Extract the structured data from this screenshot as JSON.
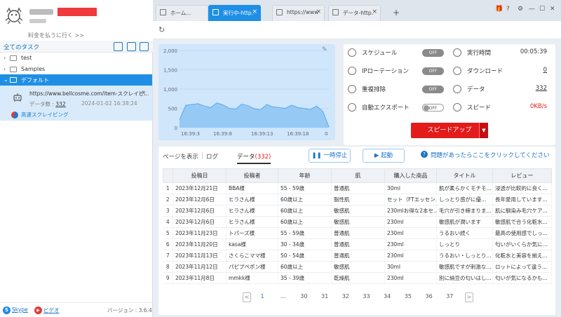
{
  "user": {
    "pay_link": "料金を払うに行く >>"
  },
  "tasks": {
    "header": "全てのタスク",
    "tree": [
      {
        "label": "test",
        "expanded": false
      },
      {
        "label": "Samples",
        "expanded": false
      },
      {
        "label": "デフォルト",
        "expanded": true,
        "selected": true
      }
    ],
    "active_task": {
      "url": "https://www.bellcosme.com/item-スクレイピ...",
      "count_label": "データ数 : ",
      "count": "332",
      "datetime": "2024-01-02 16:38:24",
      "mode": "高速スクレイピング"
    }
  },
  "footer": {
    "skype": "Skype",
    "video": "ビデオ",
    "version": "バージョン : 3.6.4"
  },
  "tabs": [
    {
      "label": "ホーム...",
      "active": false,
      "closable": false
    },
    {
      "label": "実行中-http...",
      "active": true,
      "closable": true
    },
    {
      "label": "https://www...",
      "active": false,
      "closable": true
    },
    {
      "label": "データ-http...",
      "active": false,
      "closable": true
    }
  ],
  "chart_data": {
    "type": "area",
    "title": "",
    "xlabel": "",
    "ylabel": "",
    "ylim": [
      0,
      2000
    ],
    "y_ticks": [
      "0",
      "500",
      "1,000",
      "1,500",
      "2,000"
    ],
    "x_ticks": [
      "16:39:3",
      "16:39:8",
      "16:39:13",
      "16:39:18",
      "0"
    ],
    "x": [
      0,
      1,
      2,
      3,
      4,
      5,
      6,
      7,
      8,
      9,
      10,
      11,
      12,
      13,
      14,
      15,
      16,
      17,
      18,
      19,
      20,
      21,
      22,
      23,
      24
    ],
    "values": [
      200,
      580,
      600,
      620,
      560,
      520,
      640,
      590,
      500,
      480,
      610,
      570,
      490,
      460,
      600,
      540,
      520,
      500,
      580,
      520,
      500,
      470,
      560,
      430,
      20
    ],
    "grid": true
  },
  "settings": [
    {
      "icon": "schedule-icon",
      "label": "スケジュール",
      "toggle": "OFF"
    },
    {
      "icon": "clock-icon",
      "label": "実行時間",
      "value": "00:05:39"
    },
    {
      "icon": "globe-icon",
      "label": "IPローテーション",
      "toggle": "OFF"
    },
    {
      "icon": "download-icon",
      "label": "ダウンロード",
      "value": "0",
      "link": true
    },
    {
      "icon": "dedupe-icon",
      "label": "重複排除",
      "toggle": "OFF"
    },
    {
      "icon": "data-icon",
      "label": "データ",
      "value": "332",
      "link": true
    },
    {
      "icon": "export-icon",
      "label": "自動エクスポート",
      "toggle": "OFF",
      "toggle_style": "outline"
    },
    {
      "icon": "speed-icon",
      "label": "スピード",
      "value": "0KB/s",
      "value_color": "#e31b1b"
    }
  ],
  "speed_button": "スピードアップ",
  "data_tabs": {
    "page": "ページを表示",
    "log": "ログ",
    "data": "データ",
    "data_count": "(332)"
  },
  "actions": {
    "pause": "一時停止",
    "start": "起動",
    "help": "問題があったらここをクリックしてください"
  },
  "table": {
    "columns": [
      "",
      "投稿日",
      "投稿者",
      "年齢",
      "肌",
      "購入した商品",
      "タイトル",
      "レビュー"
    ],
    "rows": [
      [
        "1",
        "2023年12月21日",
        "BBA様",
        "55 - 59歳",
        "普通肌",
        "30ml",
        "肌が柔らかくモチモ...",
        "浸透が比較的に良く..."
      ],
      [
        "2",
        "2023年12月6日",
        "ヒラさん様",
        "60歳以上",
        "脂性肌",
        "セット（FTエッセン...",
        "しっとり感がに優...",
        "長年愛用しています..."
      ],
      [
        "3",
        "2023年12月6日",
        "ヒラさん様",
        "60歳以上",
        "敏感肌",
        "230mlお得な2本セ...",
        "毛穴が引き締まりま...",
        "肌に馴染み毛穴ケア..."
      ],
      [
        "4",
        "2023年12月6日",
        "ヒラさん様",
        "60歳以上",
        "敏感肌",
        "230ml",
        "敏感肌が潤います",
        "敏感肌で合う化粧水..."
      ],
      [
        "5",
        "2023年11月23日",
        "トパーズ様",
        "55 - 59歳",
        "普通肌",
        "230ml",
        "うるおい続く",
        "最高の使用感でしっ..."
      ],
      [
        "6",
        "2023年11月20日",
        "kasa様",
        "30 - 34歳",
        "普通肌",
        "230ml",
        "しっとり",
        "匂いがいくらか気に..."
      ],
      [
        "7",
        "2023年11月13日",
        "さくらこママ様",
        "50 - 54歳",
        "普通肌",
        "230ml",
        "うるおい・しっとり...",
        "化粧水と美容を揃え..."
      ],
      [
        "8",
        "2023年11月12日",
        "パピプペポン様",
        "60歳以上",
        "敏感肌",
        "30ml",
        "敏感肌ですが刺激な...",
        "ロットによって違う..."
      ],
      [
        "9",
        "2023年11月8日",
        "mmkk様",
        "35 - 39歳",
        "乾燥肌",
        "230ml",
        "別に納豆の匂いはし...",
        "匂いが気になるかも..."
      ]
    ]
  },
  "pagination": {
    "prev": "<",
    "next": ">",
    "pages": [
      "1",
      "...",
      "30",
      "31",
      "32",
      "33",
      "34",
      "35",
      "36",
      "37"
    ],
    "current": "1"
  }
}
